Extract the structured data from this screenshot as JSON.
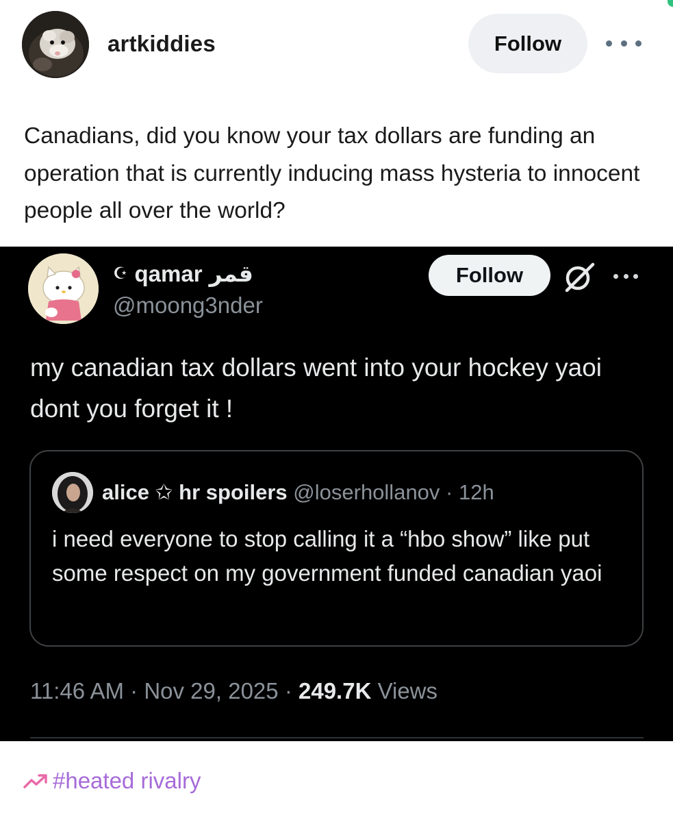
{
  "post": {
    "blog_name": "artkiddies",
    "follow_label": "Follow",
    "more_icon": "more-horizontal-icon",
    "text": "Canadians, did you know your tax dollars are funding an operation that is currently inducing mass hysteria to innocent people all over the world?"
  },
  "tweet": {
    "name": "qamar",
    "name_prefix": "☪",
    "name_arabic": "قمر",
    "handle": "@moong3nder",
    "follow_label": "Follow",
    "grok_icon": "grok-icon",
    "more_icon": "more-horizontal-icon",
    "body": "my canadian tax dollars went into your hockey yaoi dont you forget it !",
    "quote": {
      "name": "alice ✩ hr spoilers",
      "handle": "@loserhollanov",
      "separator": "·",
      "time": "12h",
      "body": "i need everyone to stop calling it a “hbo show” like put some respect on my government funded canadian yaoi"
    },
    "timestamp": "11:46 AM",
    "date": "Nov 29, 2025",
    "views_count": "249.7K",
    "views_label": "Views",
    "separator": "·"
  },
  "tags": [
    {
      "icon": "trending-up-icon",
      "label": "#heated rivalry"
    }
  ],
  "colors": {
    "tag": "#a66bd8",
    "follow_bg": "#eef0f3",
    "tweet_bg": "#000000",
    "tweet_muted": "#8b9299",
    "accent_green": "#2ec27e"
  }
}
